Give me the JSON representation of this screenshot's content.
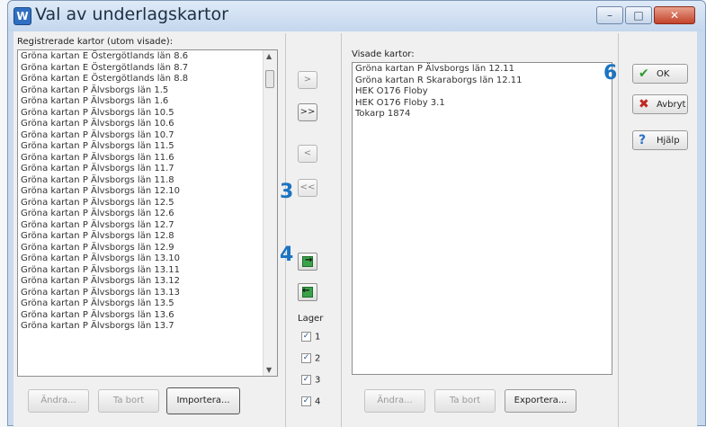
{
  "window": {
    "title": "Val av underlagskartor",
    "controls": [
      "–",
      "□",
      "✕"
    ]
  },
  "left": {
    "label": "Registrerade kartor (utom visade):",
    "items": [
      "Gröna kartan E Östergötlands län 8.6",
      "Gröna kartan E Östergötlands län 8.7",
      "Gröna kartan E Östergötlands län 8.8",
      "Gröna kartan P Älvsborgs län 1.5",
      "Gröna kartan P Älvsborgs län 1.6",
      "Gröna kartan P Älvsborgs län 10.5",
      "Gröna kartan P Älvsborgs län 10.6",
      "Gröna kartan P Älvsborgs län 10.7",
      "Gröna kartan P Älvsborgs län 11.5",
      "Gröna kartan P Älvsborgs län 11.6",
      "Gröna kartan P Älvsborgs län 11.7",
      "Gröna kartan P Älvsborgs län 11.8",
      "Gröna kartan P Älvsborgs län 12.10",
      "Gröna kartan P Älvsborgs län 12.5",
      "Gröna kartan P Älvsborgs län 12.6",
      "Gröna kartan P Älvsborgs län 12.7",
      "Gröna kartan P Älvsborgs län 12.8",
      "Gröna kartan P Älvsborgs län 12.9",
      "Gröna kartan P Älvsborgs län 13.10",
      "Gröna kartan P Älvsborgs län 13.11",
      "Gröna kartan P Älvsborgs län 13.12",
      "Gröna kartan P Älvsborgs län 13.13",
      "Gröna kartan P Älvsborgs län 13.5",
      "Gröna kartan P Älvsborgs län 13.6",
      "Gröna kartan P Älvsborgs län 13.7"
    ],
    "buttons": {
      "edit": "Ändra...",
      "remove": "Ta bort",
      "import": "Importera..."
    }
  },
  "middle": {
    "move_one_right": ">",
    "move_all_right": ">>",
    "move_one_left": "<",
    "move_all_left": "<<",
    "lager_label": "Lager",
    "layers": [
      {
        "label": "1",
        "checked": true
      },
      {
        "label": "2",
        "checked": true
      },
      {
        "label": "3",
        "checked": true
      },
      {
        "label": "4",
        "checked": true
      }
    ]
  },
  "right": {
    "label": "Visade kartor:",
    "items": [
      "Gröna kartan P Älvsborgs län 12.11",
      "Gröna kartan R Skaraborgs län 12.11",
      "HEK O176 Floby",
      "HEK O176 Floby 3.1",
      "Tokarp 1874"
    ],
    "buttons": {
      "edit": "Ändra...",
      "remove": "Ta bort",
      "export": "Exportera..."
    }
  },
  "actions": {
    "ok": "OK",
    "cancel": "Avbryt",
    "help": "Hjälp"
  },
  "callouts": {
    "c3": "3",
    "c4": "4",
    "c6": "6"
  },
  "colors": {
    "callout": "#1b74c2",
    "ok_icon": "#2e9a2e",
    "cancel_icon": "#c0281f",
    "help_icon": "#2d6fc4"
  }
}
